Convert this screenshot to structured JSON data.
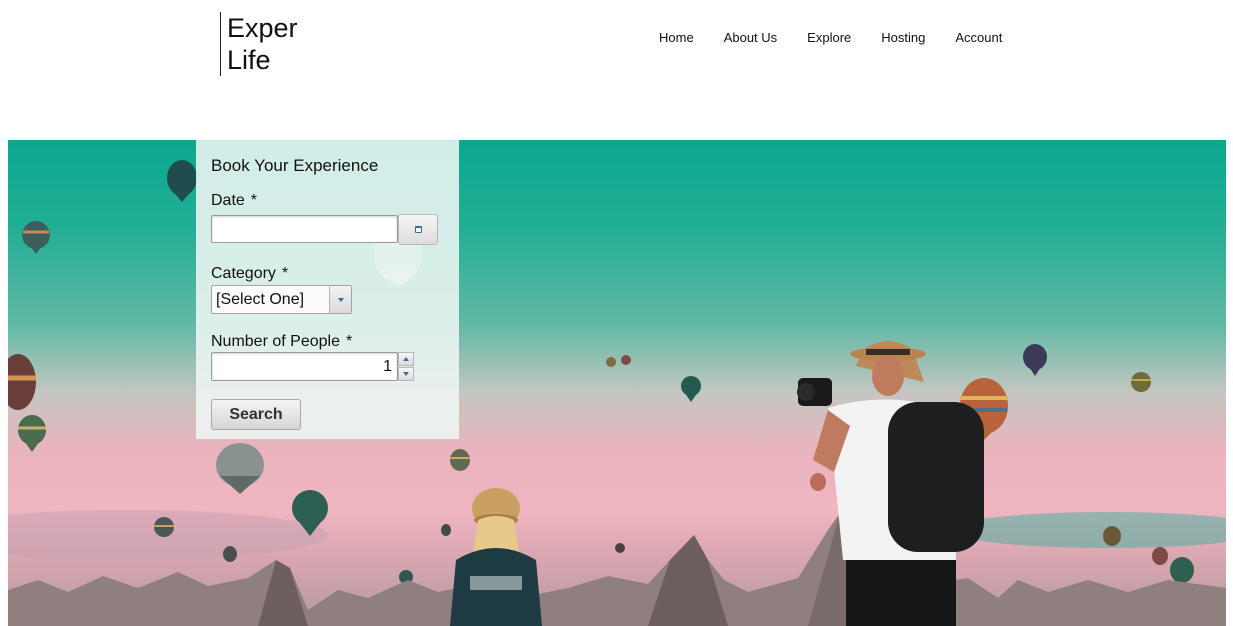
{
  "header": {
    "logo_line1": "Exper",
    "logo_line2": "Life",
    "nav": [
      "Home",
      "About Us",
      "Explore",
      "Hosting",
      "Account"
    ]
  },
  "booking": {
    "title": "Book Your Experience",
    "date_label": "Date",
    "required_mark": "*",
    "date_value": "",
    "category_label": "Category",
    "category_selected": "[Select One]",
    "people_label": "Number of People",
    "people_value": "1",
    "search_label": "Search"
  },
  "hero": {
    "image": "hot-air-balloons-photographer-couple",
    "colors": {
      "sky_top": "#0aa88e",
      "sky_mid": "#61b9a4",
      "sky_horizon": "#f0b6c1",
      "rocks": "#8f7f80"
    }
  },
  "icons": {
    "calendar": "calendar-icon",
    "dropdown": "chevron-down-icon",
    "stepper": [
      "chevron-up-icon",
      "chevron-down-icon"
    ]
  }
}
